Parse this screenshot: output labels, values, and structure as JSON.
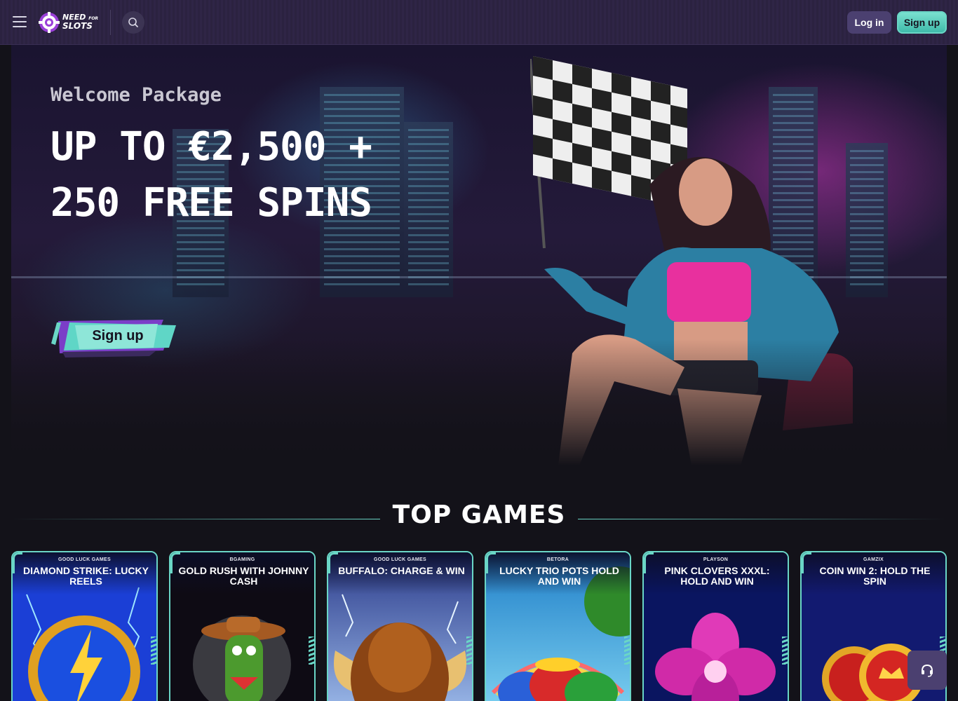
{
  "header": {
    "menu_icon": "hamburger-menu-icon",
    "logo": {
      "line1": "NEED",
      "line1_small": "FOR",
      "line2": "SLOTS",
      "icon": "chip-logo-icon"
    },
    "search_icon": "search-icon",
    "login_label": "Log in",
    "signup_label": "Sign up"
  },
  "hero": {
    "subtitle": "Welcome Package",
    "title": "UP TO €2,500 + 250 FREE SPINS",
    "cta_label": "Sign up"
  },
  "top_games": {
    "title": "TOP GAMES",
    "games": [
      {
        "provider": "GOOD LUCK GAMES",
        "name": "DIAMOND STRIKE: LUCKY REELS",
        "theme": "lightning-diamond",
        "color": "#1b3fd6"
      },
      {
        "provider": "BGAMING",
        "name": "GOLD RUSH WITH JOHNNY CASH",
        "theme": "cactus-cowboy",
        "color": "#0e0b14"
      },
      {
        "provider": "GOOD LUCK GAMES",
        "name": "BUFFALO: CHARGE & WIN",
        "theme": "buffalo-storm",
        "color": "#2a3a8a"
      },
      {
        "provider": "BETORA",
        "name": "LUCKY TRIO POTS HOLD AND WIN",
        "theme": "pots-of-gold",
        "color": "#3aa0d8"
      },
      {
        "provider": "PLAYSON",
        "name": "PINK CLOVERS XXXL: HOLD AND WIN",
        "theme": "pink-gem-clover",
        "color": "#0a1560"
      },
      {
        "provider": "GAMZIX",
        "name": "COIN WIN 2: HOLD THE SPIN",
        "theme": "gold-coins",
        "color": "#121a70"
      }
    ]
  },
  "support_icon": "headset-icon",
  "colors": {
    "accent": "#6ad6c6",
    "header_bg": "#2b2240",
    "page_bg": "#131219",
    "button_dark": "#4b4070"
  }
}
